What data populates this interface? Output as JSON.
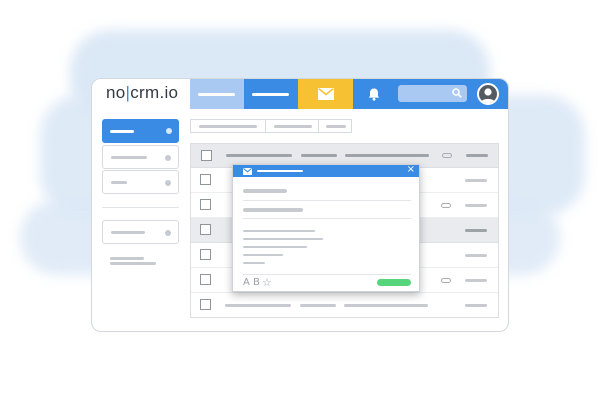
{
  "app": {
    "logo_left": "no",
    "logo_sep": "|",
    "logo_right": "crm.io"
  },
  "icons": {
    "mail": "envelope-icon",
    "bell": "bell-icon",
    "search": "search-icon",
    "user": "user-avatar-icon",
    "attachment": "paperclip-icon",
    "close": "close-icon",
    "star": "star-icon"
  },
  "popup": {
    "close_glyph": "×",
    "format_a": "A",
    "format_b": "B",
    "star_glyph": "☆"
  },
  "colors": {
    "accent_blue": "#3a8be4",
    "nav_light_blue": "#a9c9f3",
    "mail_yellow": "#f6c233",
    "send_green": "#56d57a",
    "wash_blue": "#dbe8f6"
  }
}
